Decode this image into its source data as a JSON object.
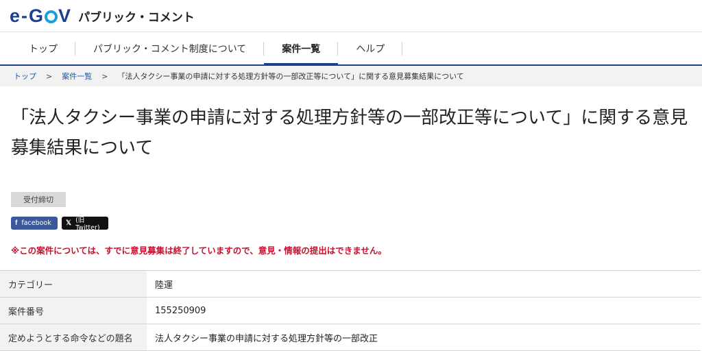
{
  "header": {
    "logo_text": "e-GOV",
    "site_name": "パブリック・コメント"
  },
  "nav": [
    {
      "label": "トップ"
    },
    {
      "label": "パブリック・コメント制度について"
    },
    {
      "label": "案件一覧",
      "active": true
    },
    {
      "label": "ヘルプ"
    }
  ],
  "breadcrumb": {
    "home": "トップ",
    "list": "案件一覧",
    "separator": ">",
    "current": "「法人タクシー事業の申請に対する処理方針等の一部改正等について」に関する意見募集結果について"
  },
  "page": {
    "title": "「法人タクシー事業の申請に対する処理方針等の一部改正等について」に関する意見募集結果について",
    "status": "受付締切",
    "share_facebook": "facebook",
    "share_x": "(旧Twitter)",
    "notice": "※この案件については、すでに意見募集は終了していますので、意見・情報の提出はできません。"
  },
  "table": [
    {
      "label": "カテゴリー",
      "value": "陸運"
    },
    {
      "label": "案件番号",
      "value": "155250909"
    },
    {
      "label": "定めようとする命令などの題名",
      "value": "法人タクシー事業の申請に対する処理方針等の一部改正"
    }
  ],
  "colors": {
    "brand_blue": "#1d3f8f",
    "notice_red": "#c8102e"
  }
}
